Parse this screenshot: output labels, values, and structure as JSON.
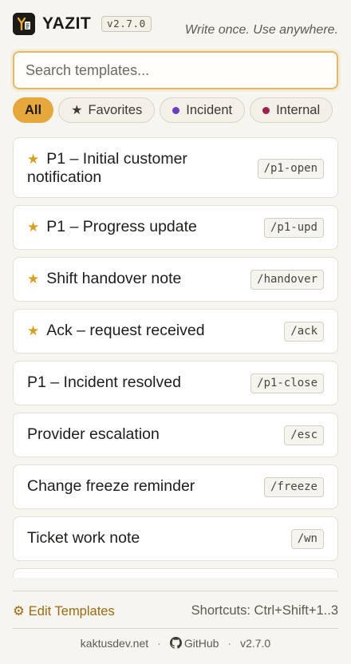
{
  "header": {
    "brand": "YAZIT",
    "version": "v2.7.0",
    "tagline": "Write once. Use anywhere."
  },
  "search": {
    "placeholder": "Search templates...",
    "value": ""
  },
  "filters": [
    {
      "label": "All",
      "active": true
    },
    {
      "label": "Favorites",
      "icon": "star-icon"
    },
    {
      "label": "Incident",
      "dot_color": "#6a3fc1"
    },
    {
      "label": "Internal",
      "dot_color": "#a01f4e"
    }
  ],
  "templates": [
    {
      "title_line1": "P1 – Initial customer",
      "title_line2": "notification",
      "command": "/p1-open",
      "favorite": true
    },
    {
      "title": "P1 – Progress update",
      "command": "/p1-upd",
      "favorite": true
    },
    {
      "title": "Shift handover note",
      "command": "/handover",
      "favorite": true
    },
    {
      "title": "Ack – request received",
      "command": "/ack",
      "favorite": true
    },
    {
      "title": "P1 – Incident resolved",
      "command": "/p1-close",
      "favorite": false
    },
    {
      "title": "Provider escalation",
      "command": "/esc",
      "favorite": false
    },
    {
      "title": "Change freeze reminder",
      "command": "/freeze",
      "favorite": false
    },
    {
      "title": "Ticket work note",
      "command": "/wn",
      "favorite": false
    }
  ],
  "bottom_bar": {
    "edit_label": "Edit Templates",
    "shortcuts_label": "Shortcuts: Ctrl+Shift+1..3"
  },
  "footer": {
    "site": "kaktusdev.net",
    "github": "GitHub",
    "version": "v2.7.0"
  },
  "colors": {
    "accent": "#e6a83c",
    "favorite_star": "#d4a023",
    "link": "#9c6a10"
  }
}
